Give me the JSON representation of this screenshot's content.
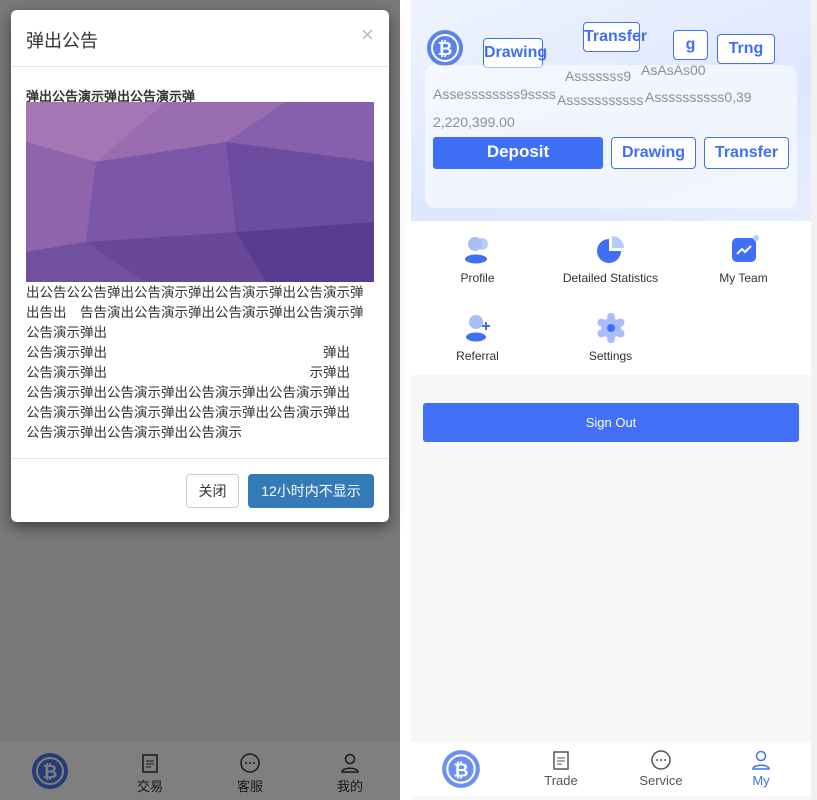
{
  "left_screen": {
    "modal": {
      "title": "弹出公告",
      "close_icon": "×",
      "heading": "弹出公告演示弹出公告演示弹",
      "body_lines": [
        "出公告公公告弹出公告演示弹出公告演示弹出公告演示弹",
        "出告出　告告演出公告演示弹出公告演示弹出公告演示弹",
        "公告演示弹出",
        "公告演示弹出　　　　　　　　　　　　　　　　弹出",
        "公告演示弹出　　　　　　　　　　　　　　　示弹出",
        "公告演示弹出公告演示弹出公告演示弹出公告演示弹出",
        "公告演示弹出公告演示弹出公告演示弹出公告演示弹出",
        "公告演示弹出公告演示弹出公告演示"
      ],
      "close_button": "关闭",
      "hide_button": "12小时内不显示"
    },
    "nav": [
      "交易",
      "客服",
      "我的"
    ]
  },
  "right_screen": {
    "ghost_texts": [
      "Drawing",
      "Transfer",
      "g",
      "Trng",
      "Asssssss9",
      "AsAsAs00",
      "Assessssssss9ssss",
      "Asssssssssss",
      "Assssssssss0,39"
    ],
    "balance": "2,220,399.00",
    "buttons": {
      "deposit": "Deposit",
      "drawing": "Drawing",
      "transfer": "Transfer"
    },
    "menu": [
      {
        "label": "Profile",
        "icon": "users-icon"
      },
      {
        "label": "Detailed Statistics",
        "icon": "pie-chart-icon"
      },
      {
        "label": "My Team",
        "icon": "trend-chart-icon"
      },
      {
        "label": "Referral",
        "icon": "add-user-icon"
      },
      {
        "label": "Settings",
        "icon": "gear-icon"
      }
    ],
    "sign_out": "Sign Out",
    "nav": [
      {
        "label": "Trade"
      },
      {
        "label": "Service"
      },
      {
        "label": "My",
        "active": true
      }
    ]
  },
  "colors": {
    "primary": "#3f6ff5",
    "modal_button": "#337ab7"
  }
}
